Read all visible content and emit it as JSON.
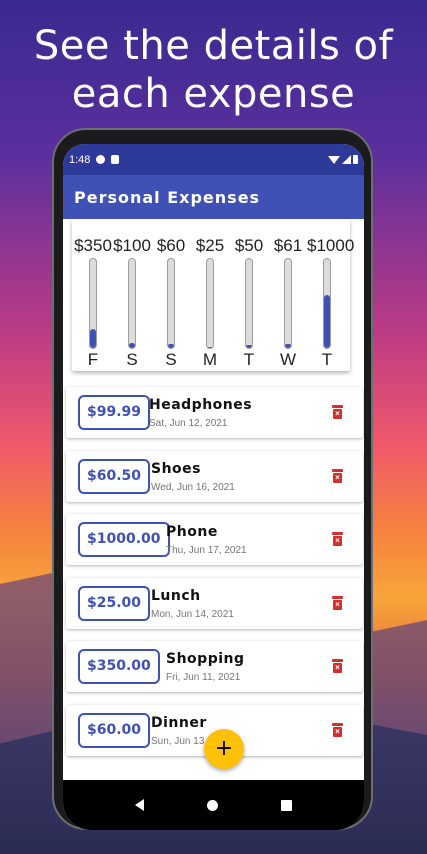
{
  "headline": {
    "line1": "See the details of",
    "line2": "each expense"
  },
  "status_bar": {
    "time": "1:48"
  },
  "app_bar": {
    "title": "Personal Expenses"
  },
  "chart_data": {
    "type": "bar",
    "categories": [
      "F",
      "S",
      "S",
      "M",
      "T",
      "W",
      "T"
    ],
    "amount_labels": [
      "$350",
      "$100",
      "$60",
      "$25",
      "$50",
      "$61",
      "$1000"
    ],
    "values": [
      350,
      100,
      60,
      25,
      50,
      61,
      1000
    ],
    "fill_fraction": [
      0.21,
      0.06,
      0.04,
      0.015,
      0.03,
      0.04,
      0.6
    ],
    "colors": {
      "fill": "#3f51b5",
      "track": "#dcdcdc"
    }
  },
  "expenses": [
    {
      "price": "$99.99",
      "title": "Headphones",
      "date": "Sat, Jun 12, 2021"
    },
    {
      "price": "$60.50",
      "title": "Shoes",
      "date": "Wed, Jun 16, 2021"
    },
    {
      "price": "$1000.00",
      "title": "Phone",
      "date": "Thu, Jun 17, 2021"
    },
    {
      "price": "$25.00",
      "title": "Lunch",
      "date": "Mon, Jun 14, 2021"
    },
    {
      "price": "$350.00",
      "title": "Shopping",
      "date": "Fri, Jun 11, 2021"
    },
    {
      "price": "$60.00",
      "title": "Dinner",
      "date": "Sun, Jun 13, 2021"
    }
  ],
  "fab": {
    "label": "+"
  },
  "icons": {
    "delete": "delete-icon",
    "add": "add-icon",
    "back": "back-icon",
    "home": "home-icon",
    "recents": "recents-icon"
  },
  "colors": {
    "primary": "#3f51b5",
    "accent": "#ffc107",
    "delete": "#d32f2f"
  }
}
